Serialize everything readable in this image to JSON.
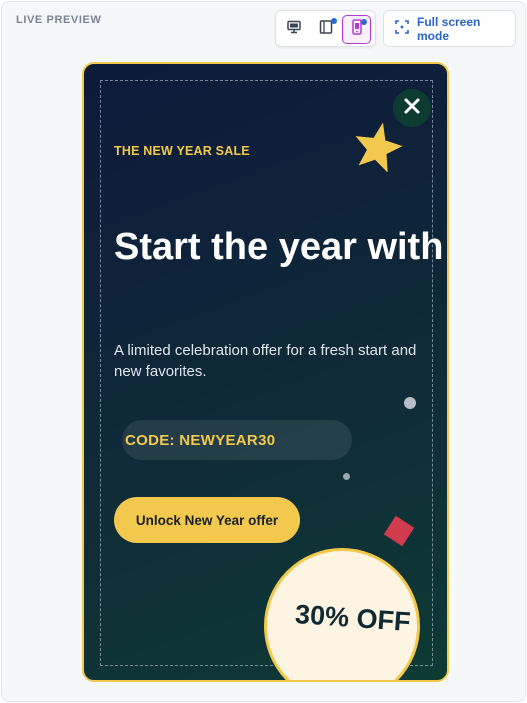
{
  "header": {
    "live_label": "LIVE PREVIEW",
    "fullscreen_label": "Full screen mode"
  },
  "devices": [
    {
      "name": "desktop-icon",
      "active": false
    },
    {
      "name": "tablet-icon",
      "active": false
    },
    {
      "name": "mobile-icon",
      "active": true
    }
  ],
  "popup": {
    "eyebrow": "THE NEW YEAR SALE",
    "headline": "Start the year with",
    "subtext": "A limited celebration offer for a fresh start and new favorites.",
    "code": "CODE: NEWYEAR30",
    "cta_label": "Unlock New Year offer",
    "badge": "30% OFF"
  },
  "colors": {
    "accent_gold": "#f2c94c",
    "active_device": "#b23ad1",
    "link_blue": "#2b64c8",
    "popup_bg": "#0d1a3a",
    "diamond": "#d13b4e"
  }
}
